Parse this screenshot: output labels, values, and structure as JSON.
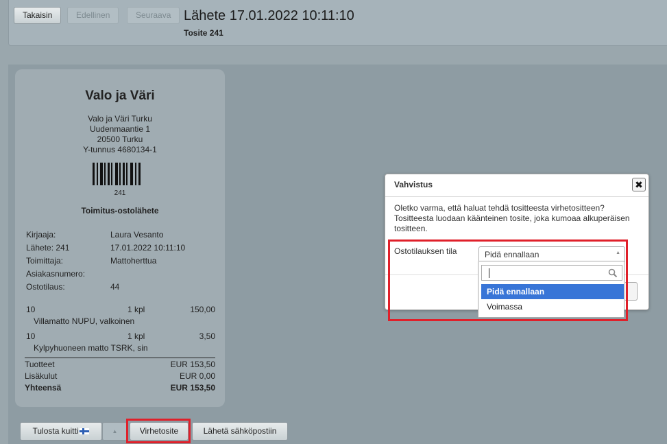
{
  "header": {
    "back_label": "Takaisin",
    "prev_label": "Edellinen",
    "next_label": "Seuraava",
    "title": "Lähete 17.01.2022 10:11:10",
    "subtitle": "Tosite 241"
  },
  "receipt": {
    "company": "Valo ja Väri",
    "address_lines": [
      "Valo ja Väri Turku",
      "Uudenmaantie 1",
      "20500 Turku",
      "Y-tunnus 4680134-1"
    ],
    "barcode_number": "241",
    "doc_type": "Toimitus-ostolähete",
    "fields": [
      {
        "label": "Kirjaaja:",
        "value": "Laura Vesanto"
      },
      {
        "label": "Lähete: 241",
        "value": "17.01.2022 10:11:10"
      },
      {
        "label": "Toimittaja:",
        "value": "Mattoherttua"
      },
      {
        "label": "Asiakasnumero:",
        "value": ""
      },
      {
        "label": "Ostotilaus:",
        "value": "44"
      }
    ],
    "items": [
      {
        "qty": "10",
        "unit": "1 kpl",
        "amount": "150,00",
        "name": "Villamatto NUPU, valkoinen"
      },
      {
        "qty": "10",
        "unit": "1 kpl",
        "amount": "3,50",
        "name": "Kylpyhuoneen matto TSRK, sin"
      }
    ],
    "totals": [
      {
        "label": "Tuotteet",
        "value": "EUR 153,50"
      },
      {
        "label": "Lisäkulut",
        "value": "EUR 0,00"
      },
      {
        "label": "Yhteensä",
        "value": "EUR 153,50"
      }
    ]
  },
  "bottom": {
    "print_label": "Tulosta kuitti",
    "dropdown_label": "▲",
    "error_voucher_label": "Virhetosite",
    "email_label": "Lähetä sähköpostiin"
  },
  "dialog": {
    "title": "Vahvistus",
    "close_symbol": "✖",
    "message": "Oletko varma, että haluat tehdä tositteesta virhetositteen? Tositteesta luodaan käänteinen tosite, joka kumoaa alkuperäisen tositteen.",
    "field_label": "Ostotilauksen tila",
    "selected_value": "Pidä ennallaan",
    "search_value": "",
    "options": [
      "Pidä ennallaan",
      "Voimassa"
    ]
  },
  "colors": {
    "highlight": "#e0202a",
    "selected_option": "#3875d7"
  }
}
